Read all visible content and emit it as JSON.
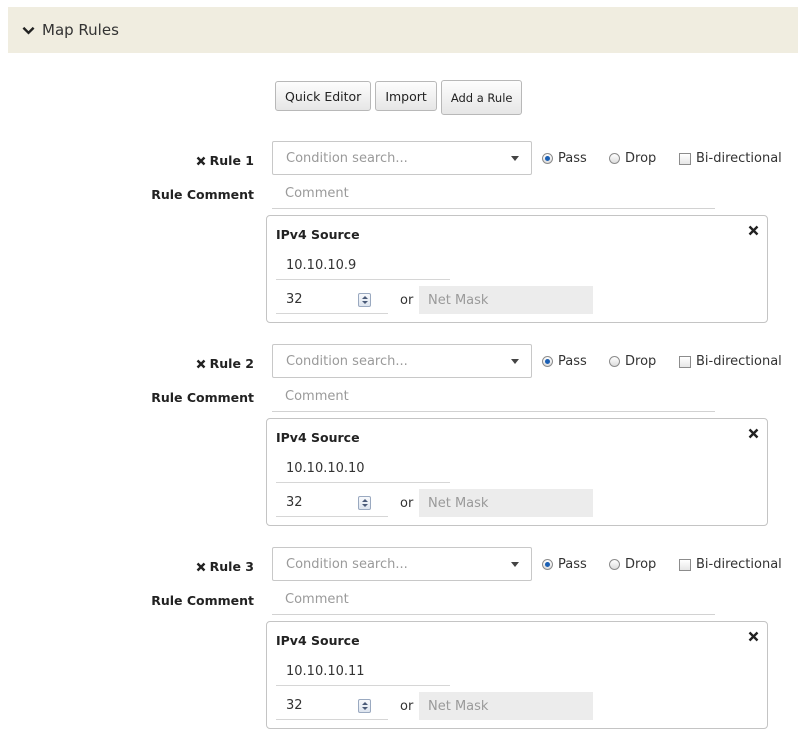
{
  "section": {
    "title": "Map Rules",
    "icon": "chevron-down-icon"
  },
  "toolbar": {
    "quick_editor": "Quick Editor",
    "import": "Import",
    "add_rule": "Add a Rule"
  },
  "colors": {
    "header_bg": "#f0ede0",
    "radio_selected": "#1a5fb4"
  },
  "rules": [
    {
      "label": "Rule 1",
      "condition_placeholder": "Condition search...",
      "options": {
        "pass": "Pass",
        "drop": "Drop",
        "bidirectional": "Bi-directional"
      },
      "selected": "Pass",
      "bidirectional_checked": false,
      "comment_label": "Rule Comment",
      "comment_placeholder": "Comment",
      "filter": {
        "title": "IPv4 Source",
        "ip": "10.10.10.9",
        "prefix": "32",
        "or": "or",
        "mask_placeholder": "Net Mask"
      }
    },
    {
      "label": "Rule 2",
      "condition_placeholder": "Condition search...",
      "options": {
        "pass": "Pass",
        "drop": "Drop",
        "bidirectional": "Bi-directional"
      },
      "selected": "Pass",
      "bidirectional_checked": false,
      "comment_label": "Rule Comment",
      "comment_placeholder": "Comment",
      "filter": {
        "title": "IPv4 Source",
        "ip": "10.10.10.10",
        "prefix": "32",
        "or": "or",
        "mask_placeholder": "Net Mask"
      }
    },
    {
      "label": "Rule 3",
      "condition_placeholder": "Condition search...",
      "options": {
        "pass": "Pass",
        "drop": "Drop",
        "bidirectional": "Bi-directional"
      },
      "selected": "Pass",
      "bidirectional_checked": false,
      "comment_label": "Rule Comment",
      "comment_placeholder": "Comment",
      "filter": {
        "title": "IPv4 Source",
        "ip": "10.10.10.11",
        "prefix": "32",
        "or": "or",
        "mask_placeholder": "Net Mask"
      }
    }
  ]
}
